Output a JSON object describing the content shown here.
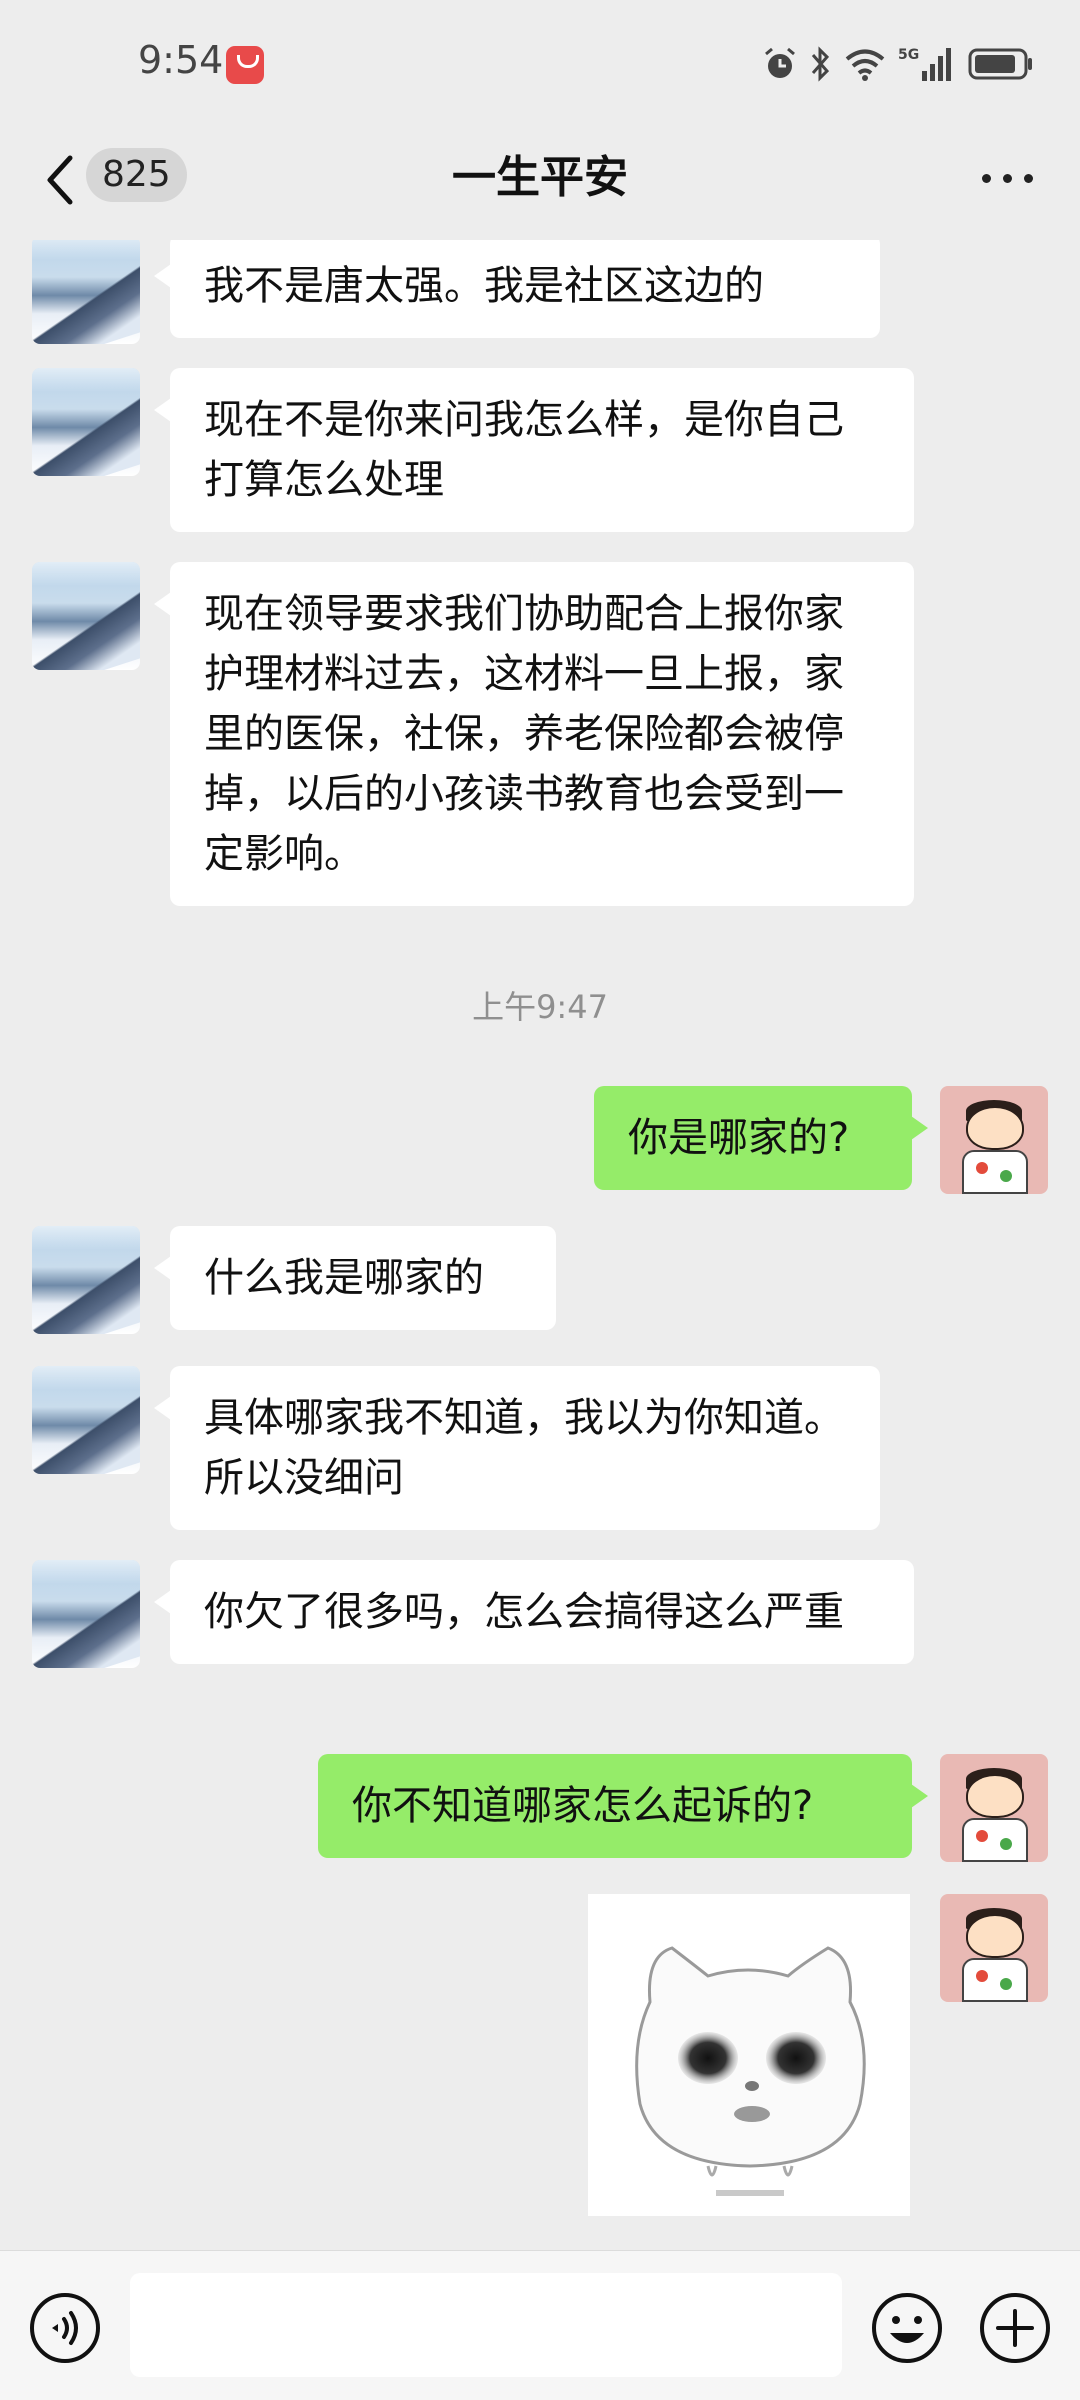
{
  "status_bar": {
    "time": "9:54",
    "app_badge_icon": "huawei-appgallery-icon",
    "icons": [
      "alarm-icon",
      "bluetooth-icon",
      "wifi-icon",
      "signal-5g-icon",
      "battery-icon"
    ]
  },
  "nav": {
    "back_icon": "chevron-left-icon",
    "unread_count": "825",
    "title": "一生平安",
    "more_icon": "more-dots-icon"
  },
  "messages": [
    {
      "side": "left",
      "text": "我不是唐太强。我是社区这边的"
    },
    {
      "side": "left",
      "text": "现在不是你来问我怎么样，是你自己打算怎么处理"
    },
    {
      "side": "left",
      "text": "现在领导要求我们协助配合上报你家护理材料过去，这材料一旦上报，家里的医保，社保，养老保险都会被停掉，以后的小孩读书教育也会受到一定影响。"
    },
    {
      "side": "time",
      "text": "上午9:47"
    },
    {
      "side": "right",
      "text": "你是哪家的?"
    },
    {
      "side": "left",
      "text": "什么我是哪家的"
    },
    {
      "side": "left",
      "text": "具体哪家我不知道，我以为你知道。所以没细问"
    },
    {
      "side": "left",
      "text": "你欠了很多吗，怎么会搞得这么严重"
    },
    {
      "side": "right",
      "text": "你不知道哪家怎么起诉的?"
    },
    {
      "side": "right",
      "sticker": "crying-cat-face-sticker"
    }
  ],
  "input_bar": {
    "voice_icon": "voice-icon",
    "text_value": "",
    "emoji_icon": "emoji-icon",
    "plus_icon": "plus-icon"
  },
  "colors": {
    "background": "#ededed",
    "incoming_bubble": "#ffffff",
    "outgoing_bubble": "#95ec69",
    "timestamp_text": "#8f8f8f"
  }
}
